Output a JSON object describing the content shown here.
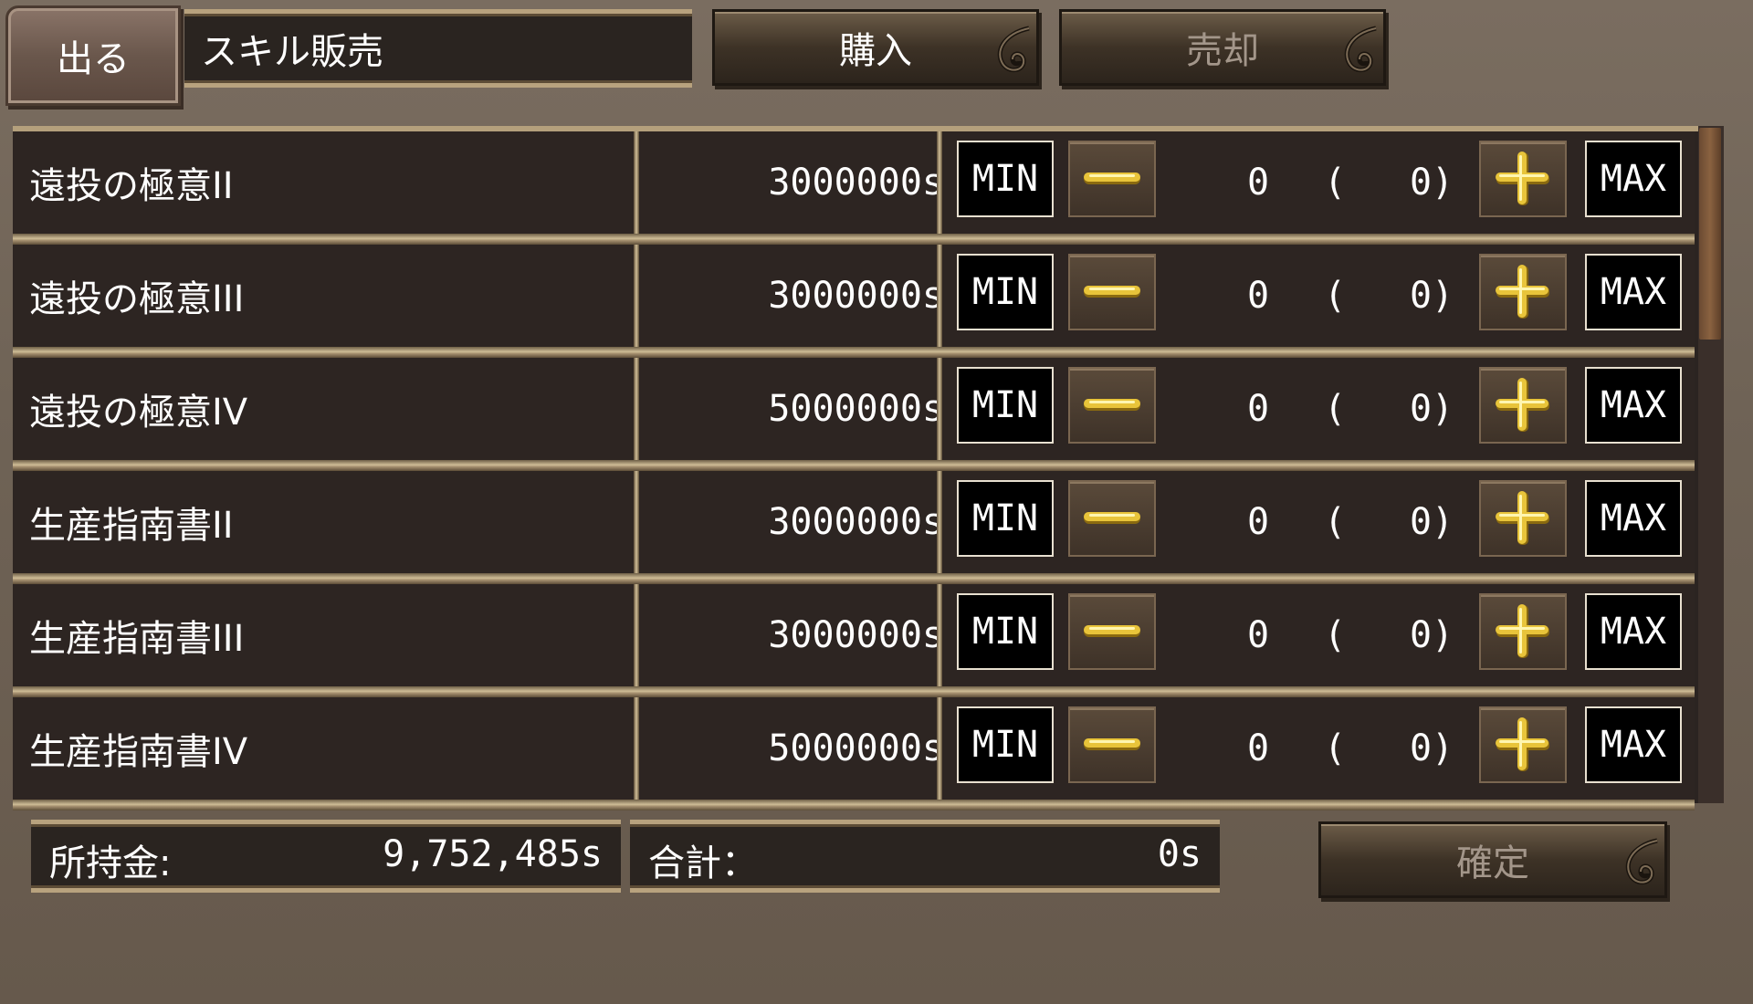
{
  "header": {
    "exit_label": "出る",
    "title": "スキル販売",
    "tab_buy_label": "購入",
    "tab_sell_label": "売却"
  },
  "items": [
    {
      "name": "遠投の極意II",
      "price": "3000000s",
      "qty": "0",
      "owned": "0"
    },
    {
      "name": "遠投の極意III",
      "price": "3000000s",
      "qty": "0",
      "owned": "0"
    },
    {
      "name": "遠投の極意IV",
      "price": "5000000s",
      "qty": "0",
      "owned": "0"
    },
    {
      "name": "生産指南書II",
      "price": "3000000s",
      "qty": "0",
      "owned": "0"
    },
    {
      "name": "生産指南書III",
      "price": "3000000s",
      "qty": "0",
      "owned": "0"
    },
    {
      "name": "生産指南書IV",
      "price": "5000000s",
      "qty": "0",
      "owned": "0"
    }
  ],
  "controls": {
    "min_label": "MIN",
    "max_label": "MAX",
    "paren_open": "(",
    "paren_close": ")"
  },
  "footer": {
    "money_label": "所持金:",
    "money_value": "9,752,485s",
    "total_label": "合計：",
    "total_value": "0s",
    "confirm_label": "確定"
  },
  "icons": {
    "minus": "minus-icon",
    "plus": "plus-icon",
    "swirl": "swirl-ornament-icon"
  },
  "colors": {
    "background": "#6f6356",
    "panel": "#2d2522",
    "gold": "#d4b23a",
    "divider": "#cfbd97",
    "disabled_text": "#a3968a"
  }
}
